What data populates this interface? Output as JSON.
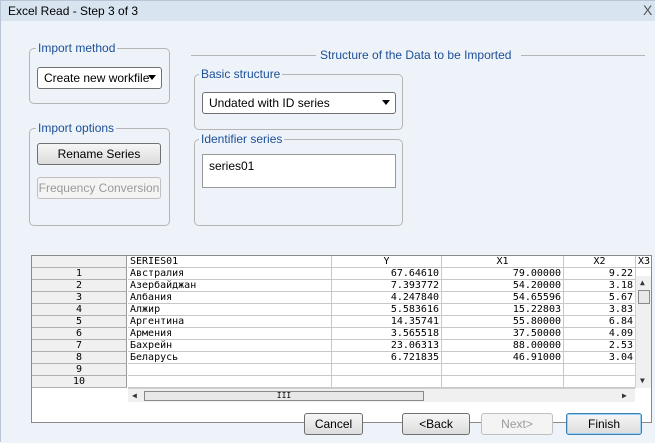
{
  "window": {
    "title": "Excel Read - Step 3 of 3",
    "close_label": "X"
  },
  "import_method": {
    "legend": "Import method",
    "selected": "Create new workfile"
  },
  "import_options": {
    "legend": "Import options",
    "rename_label": "Rename Series",
    "frequency_label": "Frequency Conversion"
  },
  "structure": {
    "title": "Structure of the Data to be Imported",
    "basic_legend": "Basic structure",
    "basic_selected": "Undated with ID series",
    "identifier_legend": "Identifier series",
    "identifier_value": "series01"
  },
  "grid": {
    "headers": [
      "SERIES01",
      "Y",
      "X1",
      "X2",
      "X3"
    ],
    "rows": [
      {
        "num": "1",
        "name": "Австралия",
        "y": "67.64610",
        "x1": "79.00000",
        "x2": "9.22"
      },
      {
        "num": "2",
        "name": "Азербайджан",
        "y": "7.393772",
        "x1": "54.20000",
        "x2": "3.18"
      },
      {
        "num": "3",
        "name": "Албания",
        "y": "4.247840",
        "x1": "54.65596",
        "x2": "5.67"
      },
      {
        "num": "4",
        "name": "Алжир",
        "y": "5.583616",
        "x1": "15.22803",
        "x2": "3.83"
      },
      {
        "num": "5",
        "name": "Аргентина",
        "y": "14.35741",
        "x1": "55.80000",
        "x2": "6.84"
      },
      {
        "num": "6",
        "name": "Армения",
        "y": "3.565518",
        "x1": "37.50000",
        "x2": "4.09"
      },
      {
        "num": "7",
        "name": "Бахрейн",
        "y": "23.06313",
        "x1": "88.00000",
        "x2": "2.53"
      },
      {
        "num": "8",
        "name": "Беларусь",
        "y": "6.721835",
        "x1": "46.91000",
        "x2": "3.04"
      },
      {
        "num": "9",
        "name": "",
        "y": "",
        "x1": "",
        "x2": ""
      },
      {
        "num": "10",
        "name": "",
        "y": "",
        "x1": "",
        "x2": ""
      }
    ],
    "hscroll_thumb": "III"
  },
  "footer": {
    "cancel_label": "Cancel",
    "back_label": "<Back",
    "next_label": "Next>",
    "finish_label": "Finish"
  }
}
